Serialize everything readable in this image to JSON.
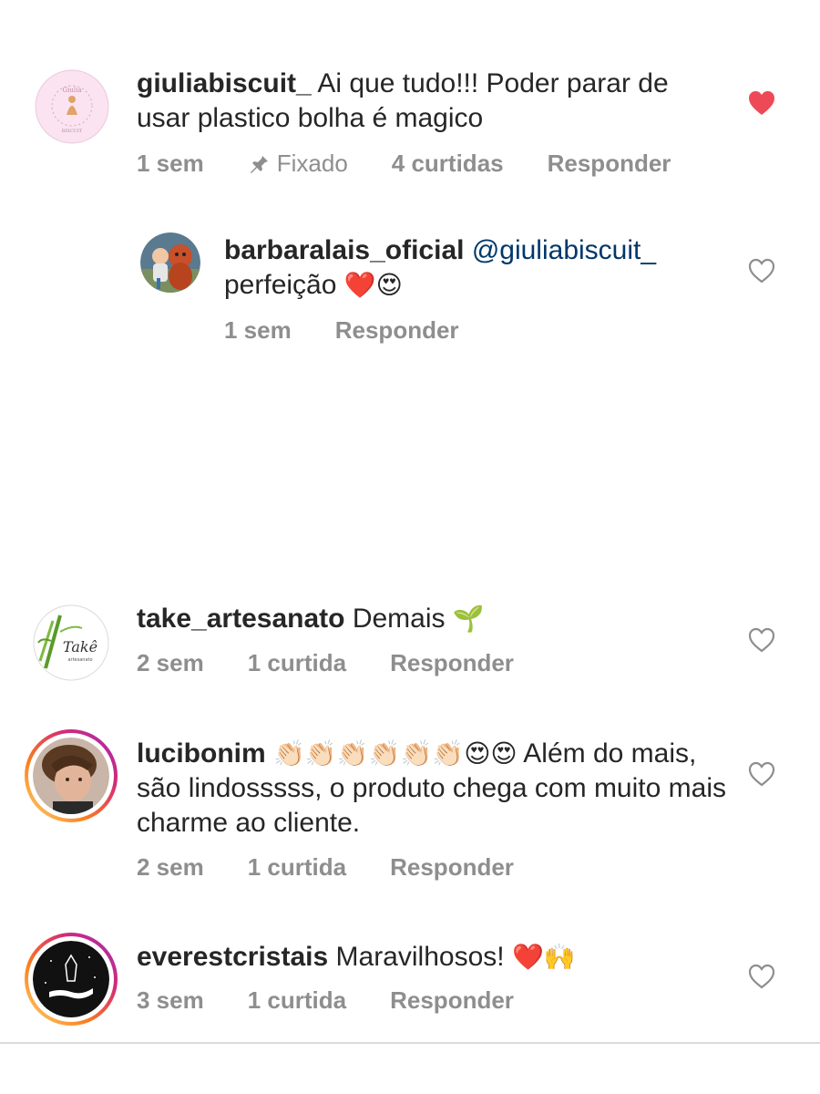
{
  "comments": [
    {
      "username": "giuliabiscuit_",
      "text": "Ai que tudo!!! Poder parar de usar plastico bolha é magico",
      "time": "1 sem",
      "pinned_label": "Fixado",
      "likes": "4 curtidas",
      "reply_label": "Responder",
      "liked": true,
      "avatar_icon": "giulia-biscuit-logo"
    },
    {
      "username": "barbaralais_oficial",
      "mention": "@giuliabiscuit_",
      "text": "perfeição",
      "emojis": "❤️😍",
      "time": "1 sem",
      "reply_label": "Responder",
      "liked": false,
      "avatar_icon": "red-panda-mascot-photo"
    },
    {
      "username": "take_artesanato",
      "text": "Demais",
      "emojis": "🌱",
      "time": "2 sem",
      "likes": "1 curtida",
      "reply_label": "Responder",
      "liked": false,
      "avatar_icon": "take-bamboo-logo"
    },
    {
      "username": "lucibonim",
      "emojis": "👏🏻👏🏻👏🏻👏🏻👏🏻👏🏻😍😍",
      "text": "Além do mais, são lindosssss, o produto chega com muito mais charme ao cliente.",
      "time": "2 sem",
      "likes": "1 curtida",
      "reply_label": "Responder",
      "liked": false,
      "avatar_icon": "profile-photo"
    },
    {
      "username": "everestcristais",
      "text": "Maravilhosos!",
      "emojis": "❤️🙌",
      "time": "3 sem",
      "likes": "1 curtida",
      "reply_label": "Responder",
      "liked": false,
      "avatar_icon": "crystal-hand-logo"
    }
  ],
  "colors": {
    "username": "#262626",
    "meta": "#8e8e8e",
    "mention": "#00376b",
    "liked_heart": "#ed4956",
    "story_ring_start": "#feda75",
    "story_ring_end": "#d62976"
  }
}
